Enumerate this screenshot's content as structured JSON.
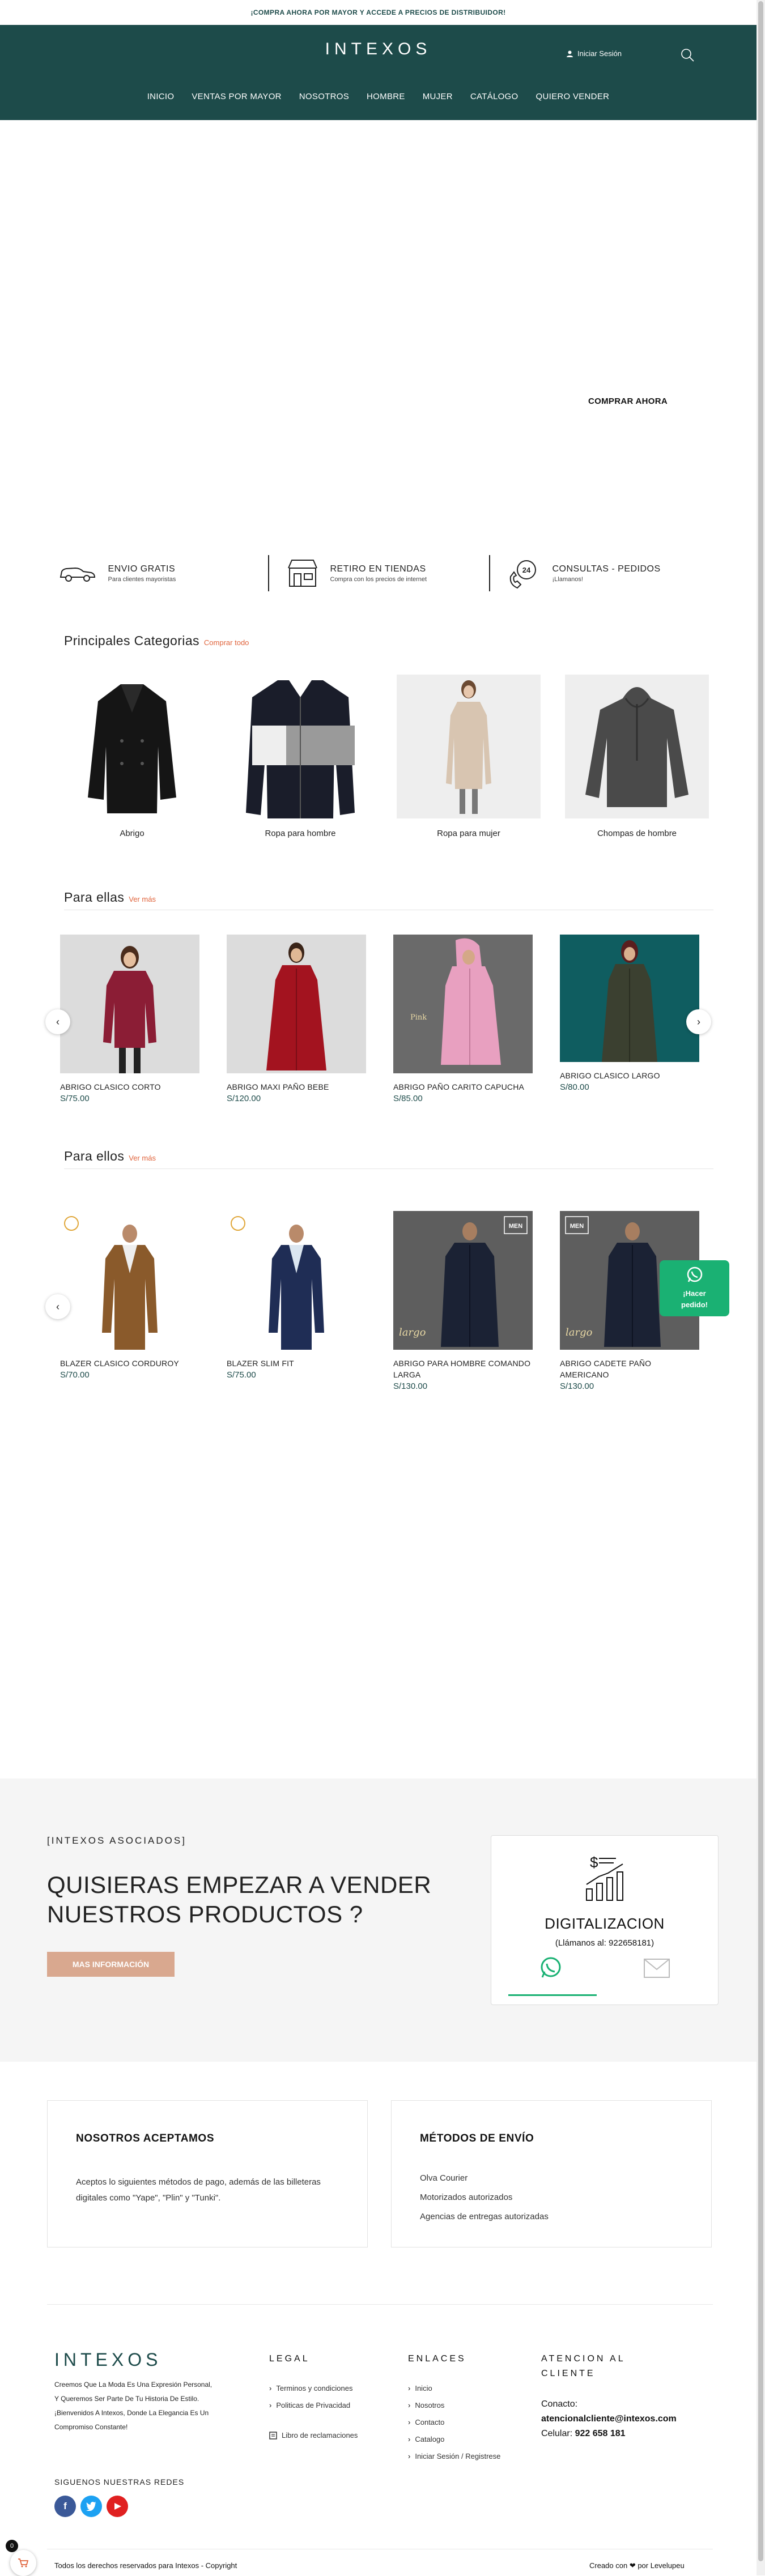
{
  "topbar": {
    "text": "¡COMPRA AHORA POR MAYOR Y ACCEDE A PRECIOS DE DISTRIBUIDOR!"
  },
  "header": {
    "logo": "INTEXOS",
    "login": "Iniciar Sesión",
    "nav": [
      "INICIO",
      "VENTAS POR MAYOR",
      "NOSOTROS",
      "HOMBRE",
      "MUJER",
      "CATÁLOGO",
      "QUIERO VENDER"
    ]
  },
  "hero": {
    "cta": "COMPRAR AHORA"
  },
  "features": [
    {
      "title": "ENVIO GRATIS",
      "sub": "Para clientes mayoristas",
      "icon": "truck-icon"
    },
    {
      "title": "RETIRO EN TIENDAS",
      "sub": "Compra con los precios de internet",
      "icon": "store-icon"
    },
    {
      "title": "CONSULTAS - PEDIDOS",
      "sub": "¡Llamanos!",
      "icon": "phone-24-icon"
    }
  ],
  "categories": {
    "title": "Principales Categorias",
    "link": "Comprar todo",
    "items": [
      "Abrigo",
      "Ropa para hombre",
      "Ropa para mujer",
      "Chompas de hombre"
    ]
  },
  "women": {
    "title": "Para ellas",
    "link": "Ver más",
    "products": [
      {
        "name": "ABRIGO CLASICO CORTO",
        "price": "S/75.00",
        "color": "#8b1d35",
        "bg": "#dcdcdc"
      },
      {
        "name": "ABRIGO MAXI PAÑO BEBE",
        "price": "S/120.00",
        "color": "#a3131f",
        "bg": "#dcdcdc"
      },
      {
        "name": "ABRIGO PAÑO CARITO CAPUCHA",
        "price": "S/85.00",
        "color": "#e8a0c0",
        "bg": "#6a6a6a"
      },
      {
        "name": "ABRIGO CLASICO LARGO",
        "price": "S/80.00",
        "color": "#3b4030",
        "bg": "#0f5d60"
      }
    ]
  },
  "men": {
    "title": "Para ellos",
    "link": "Ver más",
    "products": [
      {
        "name": "BLAZER CLASICO CORDUROY",
        "price": "S/70.00",
        "color": "#8a5a2b",
        "bg": "#ffffff"
      },
      {
        "name": "BLAZER SLIM FIT",
        "price": "S/75.00",
        "color": "#1f2d55",
        "bg": "#ffffff"
      },
      {
        "name": "ABRIGO PARA HOMBRE COMANDO LARGA",
        "price": "S/130.00",
        "color": "#1b2234",
        "bg": "#5e5e5e"
      },
      {
        "name": "ABRIGO CADETE PAÑO AMERICANO",
        "price": "S/130.00",
        "color": "#1b2234",
        "bg": "#5e5e5e"
      }
    ]
  },
  "whatsapp": {
    "label": "¡Hacer pedido!"
  },
  "vender": {
    "eyebrow": "[INTEXOS ASOCIADOS]",
    "title": "QUISIERAS EMPEZAR A VENDER NUESTROS PRODUCTOS ?",
    "button": "MAS INFORMACIÓN",
    "card_title": "DIGITALIZACION",
    "card_sub": "(Llámanos al: 922658181)"
  },
  "payments": {
    "title": "NOSOTROS ACEPTAMOS",
    "text": "Aceptos lo siguientes métodos de pago, además de las billeteras digitales como \"Yape\", \"Plin\" y \"Tunki\"."
  },
  "shipping": {
    "title": "MÉTODOS DE ENVÍO",
    "items": [
      "Olva Courier",
      "Motorizados autorizados",
      "Agencias de entregas autorizadas"
    ]
  },
  "footer": {
    "logo": "INTEXOS",
    "about": "Creemos Que La Moda Es Una Expresión Personal, Y Queremos Ser Parte De Tu Historia De Estilo. ¡Bienvenidos A Intexos, Donde La Elegancia Es Un Compromiso Constante!",
    "social_title": "SIGUENOS NUESTRAS REDES",
    "legal_title": "LEGAL",
    "legal_items": [
      "Terminos y condiciones",
      "Politicas de Privacidad"
    ],
    "complaints": "Libro de reclamaciones",
    "links_title": "ENLACES",
    "links": [
      "Inicio",
      "Nosotros",
      "Contacto",
      "Catalogo",
      "Iniciar Sesión / Registrese"
    ],
    "support_title": "ATENCION AL CLIENTE",
    "contact_label": "Conacto:",
    "email": "atencionalcliente@intexos.com",
    "phone_label": "Celular:",
    "phone": "922 658 181",
    "copyright": "Todos los derechos reservados para Intexos - Copyright",
    "credit": "Creado con ❤ por Levelupeu"
  },
  "cart": {
    "count": "0"
  },
  "colors": {
    "brand": "#1d4b4a",
    "accent": "#e0633b",
    "whatsapp": "#1ab173",
    "button": "#d9a88f"
  }
}
